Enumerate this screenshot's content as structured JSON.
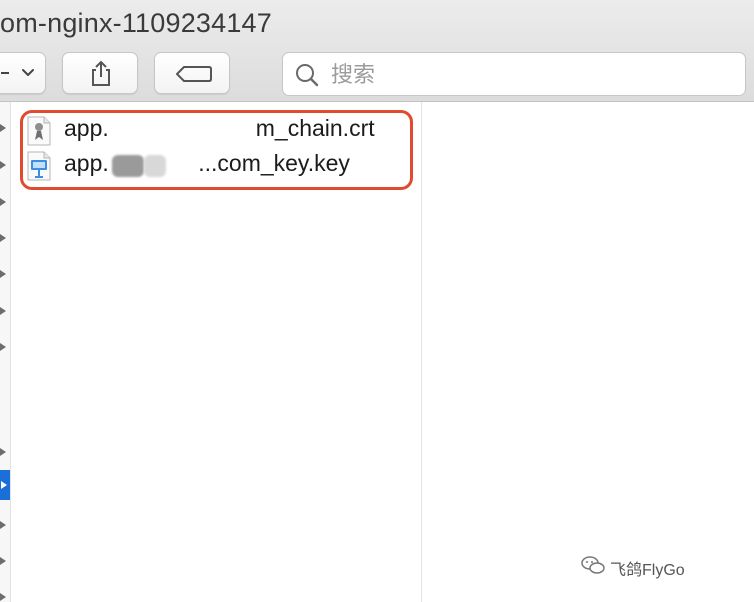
{
  "window": {
    "title": "om-nginx-1109234147"
  },
  "toolbar": {
    "buttons": [
      {
        "name": "view-options",
        "icon": "chevron-down-icon"
      },
      {
        "name": "share",
        "icon": "share-icon"
      },
      {
        "name": "tags",
        "icon": "tag-icon"
      }
    ],
    "search": {
      "placeholder": "搜索",
      "value": "",
      "icon": "magnifier-icon"
    }
  },
  "files": [
    {
      "name": "app.                       m_chain.crt",
      "icon": "certificate-icon"
    },
    {
      "name": "app.              ...com_key.key",
      "icon": "keynote-key-icon"
    }
  ],
  "colors": {
    "selection": "#1b6fd8",
    "highlight_border": "#e24a2f"
  },
  "watermark": {
    "text": "飞鸽FlyGo",
    "icon": "wechat-icon"
  }
}
